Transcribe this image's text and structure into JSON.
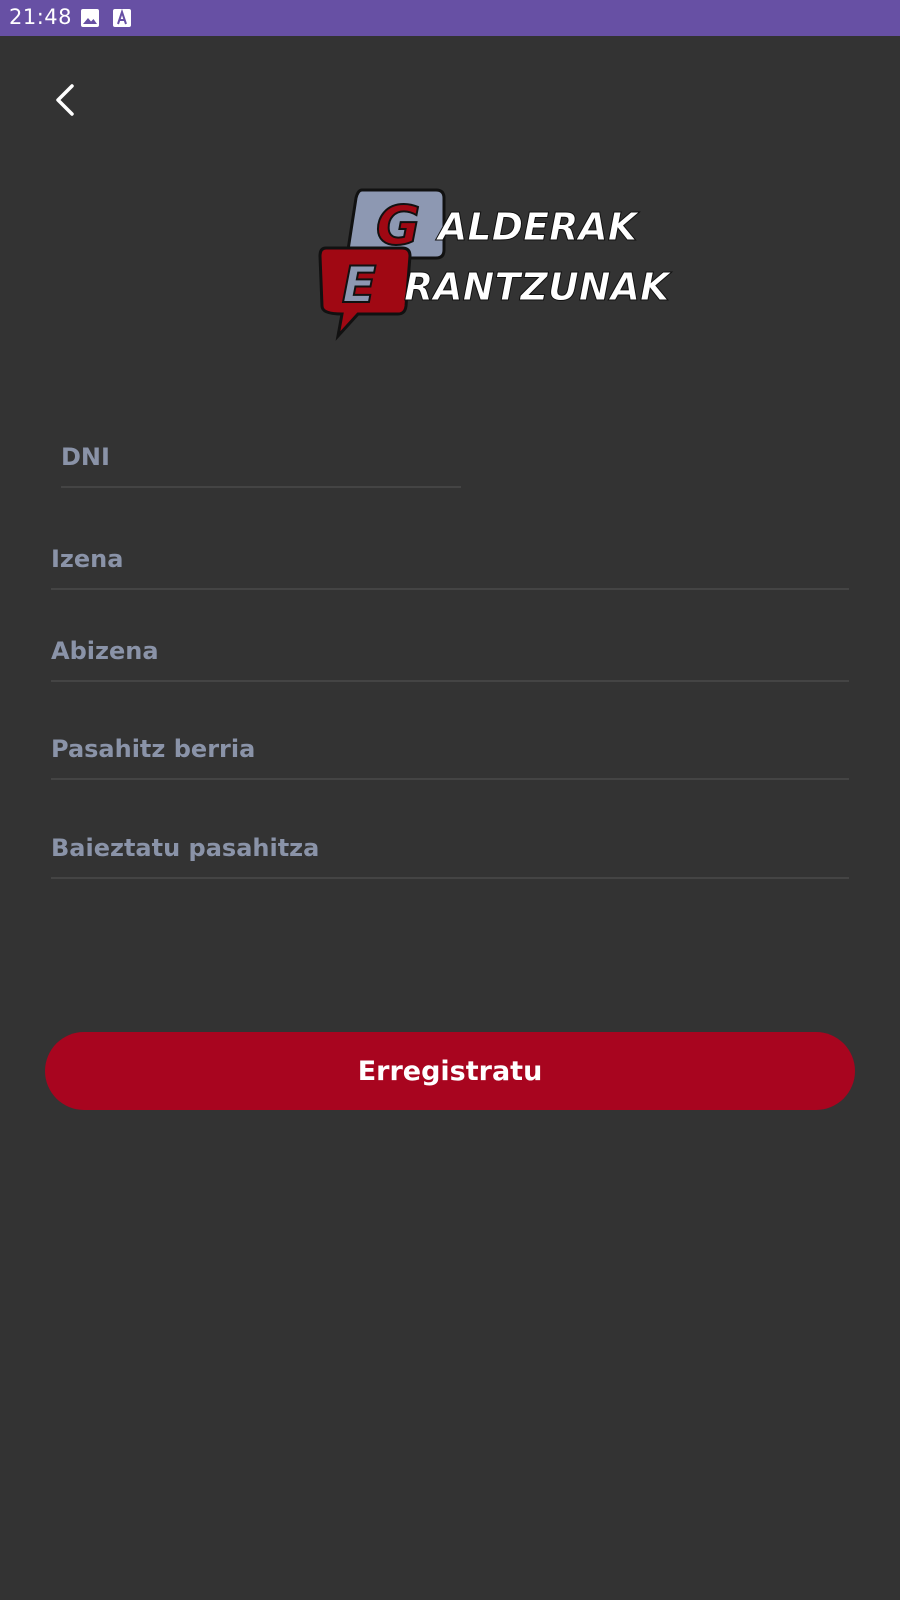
{
  "status_bar": {
    "time": "21:48",
    "icons": [
      "image-icon",
      "a-box-icon"
    ],
    "background": "#6750a4"
  },
  "header": {
    "back_icon": "chevron-left-icon"
  },
  "logo": {
    "top_letter": "G",
    "top_word": "ALDERAK",
    "bottom_letter": "E",
    "bottom_word": "RANTZUNAK"
  },
  "form": {
    "dni": {
      "placeholder": "DNI",
      "value": ""
    },
    "name": {
      "placeholder": "Izena",
      "value": ""
    },
    "surname": {
      "placeholder": "Abizena",
      "value": ""
    },
    "new_password": {
      "placeholder": "Pasahitz berria",
      "value": ""
    },
    "confirm_password": {
      "placeholder": "Baieztatu pasahitza",
      "value": ""
    }
  },
  "register_button": {
    "label": "Erregistratu",
    "color": "#a8051f"
  },
  "colors": {
    "background": "#333333",
    "placeholder": "#8a93a8",
    "underline": "#444444",
    "accent_red": "#a8051f",
    "logo_gray": "#8d98b2"
  }
}
